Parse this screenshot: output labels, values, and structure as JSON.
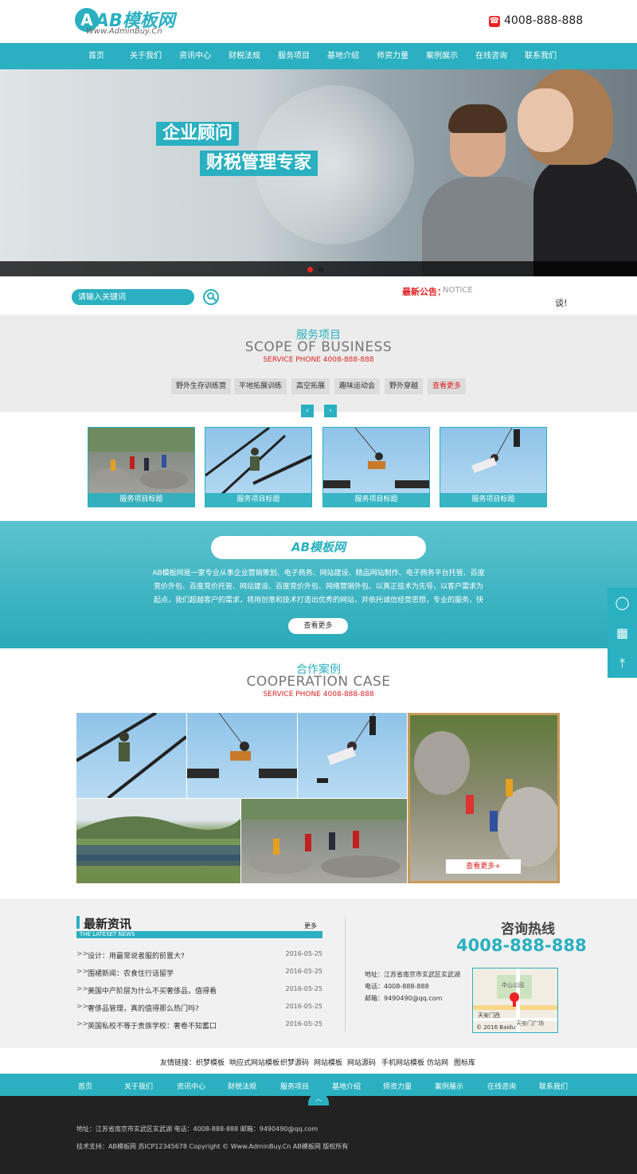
{
  "colors": {
    "accent": "#2ab0c0",
    "notice": "#dd2222",
    "footer_bg": "#222222",
    "scope_bg": "#ececec"
  },
  "header": {
    "logo_text": "AB模板网",
    "logo_url": "Www.AdminBuy.Cn",
    "phone_icon": "phone-icon",
    "hotline": "4008-888-888"
  },
  "nav": [
    "首页",
    "关于我们",
    "资讯中心",
    "财税法规",
    "服务项目",
    "基地介绍",
    "师资力量",
    "案例展示",
    "在线咨询",
    "联系我们"
  ],
  "banner": {
    "line1": "企业顾问",
    "line2": "财税管理专家",
    "slides": 2,
    "active_slide": 1
  },
  "search": {
    "placeholder": "请输入关键词",
    "notice_label": "最新公告：",
    "notice_en": "NOTICE",
    "notice_text": "谈!"
  },
  "scope": {
    "title_cn": "服务项目",
    "title_en": "SCOPE OF BUSINESS",
    "phone": "SERVICE PHONE 4008-888-888",
    "tags": [
      "野外生存训练营",
      "平地拓展训练",
      "高空拓展",
      "趣味运动会",
      "野外穿越",
      "查看更多"
    ],
    "prev_icon": "chevron-left-icon",
    "next_icon": "chevron-right-icon",
    "cards": [
      "服务项目标题",
      "服务项目标题",
      "服务项目标题",
      "服务项目标题"
    ]
  },
  "about": {
    "logo_text": "AB模板网",
    "text": "AB模板网是一家专业从事企业营销策划、电子商务、网站建设、精品网站制作、电子商务平台托管、百度竞价外包、百度竞价托管、网站建设、百度竞价外包、网络营销外包、以真正技术为先导，以客户需求为起点，我们超越客户的需求，将用创意和技术打造出优秀的网站，并依托诚信经营思想，专业的服务，快速的发展，我们迎来了越来越多客户的信任，坚持我们的理念，切实给客户提供更好的服务。",
    "more": "查看更多"
  },
  "side": {
    "qq_icon": "qq-icon",
    "qrcode_icon": "qrcode-icon",
    "top_icon": "back-to-top-icon"
  },
  "cases": {
    "title_cn": "合作案例",
    "title_en": "COOPERATION CASE",
    "phone": "SERVICE PHONE 4008-888-888",
    "more": "查看更多+"
  },
  "news": {
    "title": "最新资讯",
    "subtitle": "THE LATESET NEWS",
    "more": "更多",
    "items": [
      {
        "title": "设计：用最常说者服的前置大?",
        "date": "2016-05-25"
      },
      {
        "title": "围裙新闻：农食住行话留学",
        "date": "2016-05-25"
      },
      {
        "title": "美国中产阶层为什么不买奢侈品，值得看",
        "date": "2016-05-25"
      },
      {
        "title": "奢侈品管理，真的值得那么热门吗?",
        "date": "2016-05-25"
      },
      {
        "title": "英国私校不等于贵族学校：奢卷不知蓄口",
        "date": "2016-05-25"
      }
    ]
  },
  "contact": {
    "label": "咨询热线",
    "phone": "4008-888-888",
    "address": "地址：江苏省南京市玄武区玄武湖",
    "tel": "电话：4008-888-888",
    "email": "邮箱：9490490@qq.com",
    "map_labels": [
      "中山公园",
      "天安门西",
      "天安门广场",
      "© 2016 Baidu"
    ]
  },
  "links": [
    "友情链接：",
    "织梦模板",
    "响应式网站模板",
    "织梦源码",
    "网站模板",
    "网站源码",
    "手机网站模板",
    "仿站网",
    "图标库"
  ],
  "footer_nav": [
    "首页",
    "关于我们",
    "资讯中心",
    "财税法规",
    "服务项目",
    "基地介绍",
    "师资力量",
    "案例展示",
    "在线咨询",
    "联系我们"
  ],
  "footer": {
    "up_icon": "up-arrow-icon",
    "line1": "地址：江苏省南京市玄武区玄武湖  电话：4008-888-888  邮箱：9490490@qq.com",
    "line2": "技术支持：AB模板网  苏ICP12345678  Copyright © Www.AdminBuy.Cn AB模板网 版权所有"
  }
}
